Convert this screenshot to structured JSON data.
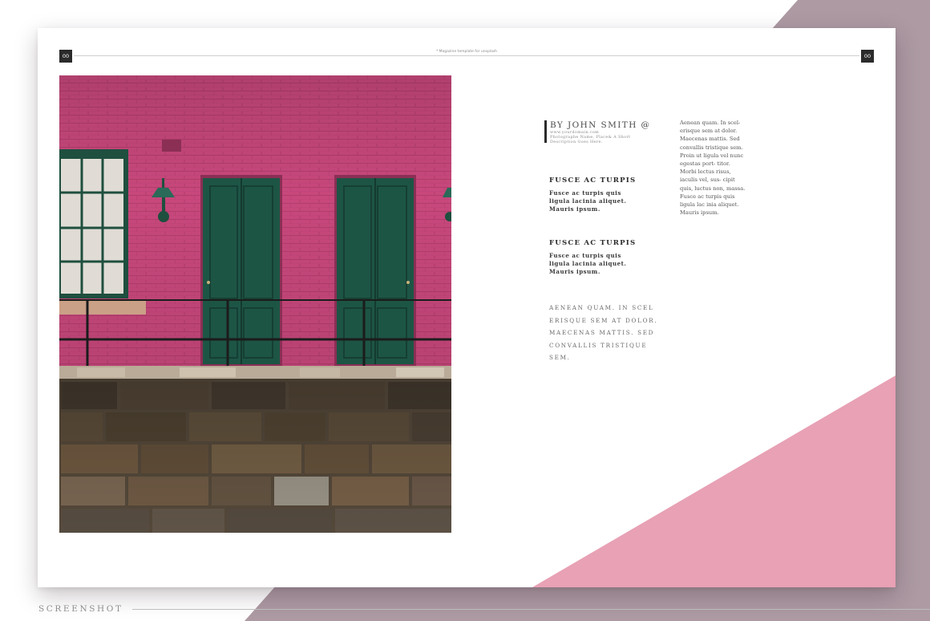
{
  "colors": {
    "mauve": "#ad9aa3",
    "pink_accent": "#e8a1b5",
    "wall_pink": "#c8487c",
    "door_green": "#1d5545"
  },
  "header": {
    "page_left": "00",
    "page_right": "00",
    "note": "* Magazine template for unsplash"
  },
  "photo": {
    "subject": "pink brick building with green doors"
  },
  "byline": {
    "author": "BY JOHN SMITH @",
    "website": "www.yourdomain.com",
    "caption": "Photographe Name, Place& A Short Description Goes Here."
  },
  "sections": [
    {
      "heading": "FUSCE AC TURPIS",
      "body": "Fusce ac turpis quis ligula lacinia aliquet. Mauris ipsum."
    },
    {
      "heading": "FUSCE AC TURPIS",
      "body": "Fusce ac turpis quis ligula lacinia aliquet. Mauris ipsum."
    }
  ],
  "caps_paragraph": "Aenean quam. In scel erisque sem at dolor. Maecenas mattis. Sed convallis tristique sem.",
  "side_column": "Aenean quam. In scel- erisque sem at dolor. Maecenas mattis. Sed convallis tristique sem. Proin ut ligula vel nunc egestas port- titor. Morbi lectus risus, iaculis vel, sus- cipit quis, luctus non, massa. Fusce ac turpis quis ligula lac inia aliquet. Mauris ipsum.",
  "footer": {
    "label": "SCREENSHOT"
  }
}
